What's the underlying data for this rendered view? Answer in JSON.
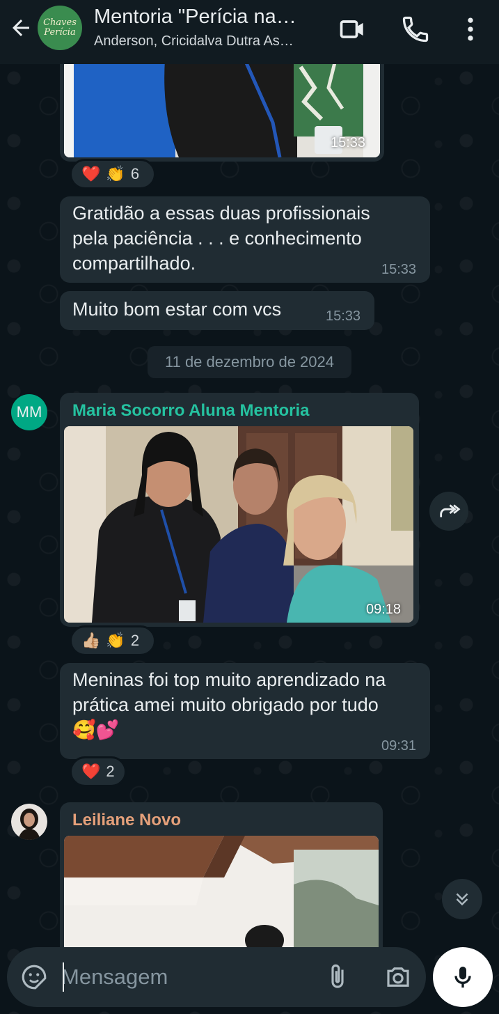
{
  "header": {
    "title": "Mentoria \"Perícia na…",
    "subtitle": "Anderson, Cricidalva Dutra As…",
    "avatar_line1": "Chaves",
    "avatar_line2": "Perícia"
  },
  "messages": {
    "top_photo_time": "15:33",
    "top_photo_reaction_count": "6",
    "msg1_text": "Gratidão a essas duas profissionais pela paciência . . . e conhecimento compartilhado.",
    "msg1_time": "15:33",
    "msg2_text": "Muito bom estar com vcs",
    "msg2_time": "15:33",
    "date_divider": "11 de dezembro de 2024",
    "sender1_initials": "MM",
    "sender1_name": "Maria Socorro Aluna Mentoria",
    "sender1_photo_time": "09:18",
    "sender1_photo_reaction_count": "2",
    "msg3_text": "Meninas foi top muito aprendizado na prática amei muito obrigado por tudo 🥰💕",
    "msg3_time": "09:31",
    "msg3_reaction_count": "2",
    "sender2_name": "Leiliane Novo"
  },
  "composer": {
    "placeholder": "Mensagem"
  },
  "colors": {
    "background": "#0b141a",
    "bubble": "#202c33",
    "sender1_name": "#25c2a0",
    "sender2_name": "#e5a07a",
    "mm_avatar": "#00a884"
  }
}
